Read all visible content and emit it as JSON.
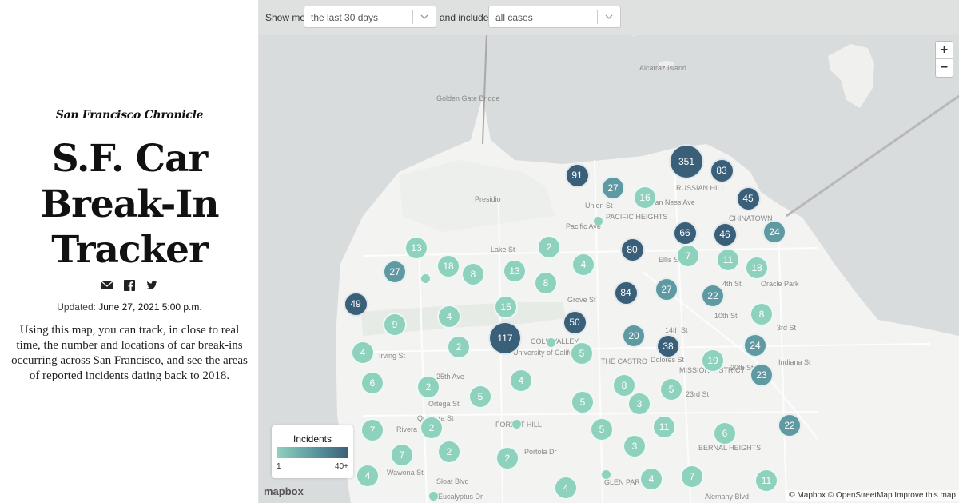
{
  "brand": "San Francisco Chronicle",
  "title_lines": [
    "S.F. Car",
    "Break-In",
    "Tracker"
  ],
  "share": {
    "email_icon": "email-icon",
    "facebook_icon": "facebook-icon",
    "twitter_icon": "twitter-icon"
  },
  "updated": {
    "label": "Updated:",
    "value": "June 27, 2021 5:00 p.m."
  },
  "intro": "Using this map, you can track, in close to real time, the number and locations of car break-ins occurring across San Francisco, and see the areas of reported incidents dating back to 2018.",
  "controls": {
    "show_me_label": "Show me",
    "period_value": "the last 30 days",
    "include_label": "and include",
    "cases_value": "all cases"
  },
  "zoom": {
    "in": "+",
    "out": "−"
  },
  "legend": {
    "title": "Incidents",
    "min": "1",
    "max": "40+"
  },
  "colors": {
    "low": "#8ed2bd",
    "mid": "#5f9aa3",
    "high": "#3a5f78",
    "water": "#d9dcdc",
    "land": "#f3f3f2"
  },
  "mapbox_logo": "mapbox",
  "attribution": "© Mapbox © OpenStreetMap Improve this map",
  "map_labels": [
    "Alcatraz Island",
    "Golden Gate Bridge",
    "Presidio",
    "RUSSIAN HILL",
    "Union St",
    "PACIFIC HEIGHTS",
    "CHINATOWN",
    "Pacific Ave",
    "Lake St",
    "Ellis St",
    "Oracle Park",
    "Grove St",
    "COLE VALLEY",
    "University of California",
    "Irving St",
    "14th St",
    "THE CASTRO",
    "MISSION DISTRICT",
    "20th St",
    "23rd St",
    "25th Ave",
    "Ortega St",
    "Quintara St",
    "Rivera St",
    "FOREST HILL",
    "Portola Dr",
    "Wawona St",
    "Sloat Blvd",
    "Eucalyptus Dr",
    "GLEN PARK",
    "BERNAL HEIGHTS",
    "Van Ness Ave",
    "10th St",
    "4th St",
    "3rd St",
    "Indiana St",
    "Dolores St",
    "Alemany Blvd"
  ],
  "clusters": [
    {
      "count": 351,
      "level": "high"
    },
    {
      "count": 83,
      "level": "high"
    },
    {
      "count": 91,
      "level": "high"
    },
    {
      "count": 27,
      "level": "mid"
    },
    {
      "count": 16,
      "level": "low"
    },
    {
      "count": 45,
      "level": "high"
    },
    {
      "count": 66,
      "level": "high"
    },
    {
      "count": 46,
      "level": "high"
    },
    {
      "count": 24,
      "level": "mid"
    },
    {
      "count": 13,
      "level": "low"
    },
    {
      "count": 2,
      "level": "low"
    },
    {
      "count": 80,
      "level": "high"
    },
    {
      "count": 7,
      "level": "low"
    },
    {
      "count": 11,
      "level": "low"
    },
    {
      "count": 18,
      "level": "low"
    },
    {
      "count": 27,
      "level": "mid"
    },
    {
      "count": 18,
      "level": "low"
    },
    {
      "count": 8,
      "level": "low"
    },
    {
      "count": 13,
      "level": "low"
    },
    {
      "count": 4,
      "level": "low"
    },
    {
      "count": 8,
      "level": "low"
    },
    {
      "count": 84,
      "level": "high"
    },
    {
      "count": 27,
      "level": "mid"
    },
    {
      "count": 22,
      "level": "mid"
    },
    {
      "count": 49,
      "level": "high"
    },
    {
      "count": 15,
      "level": "low"
    },
    {
      "count": 9,
      "level": "low"
    },
    {
      "count": 4,
      "level": "low"
    },
    {
      "count": 50,
      "level": "high"
    },
    {
      "count": 8,
      "level": "low"
    },
    {
      "count": 117,
      "level": "high"
    },
    {
      "count": 2,
      "level": "low"
    },
    {
      "count": 20,
      "level": "mid"
    },
    {
      "count": 38,
      "level": "high"
    },
    {
      "count": 24,
      "level": "mid"
    },
    {
      "count": 4,
      "level": "low"
    },
    {
      "count": 5,
      "level": "low"
    },
    {
      "count": 19,
      "level": "low"
    },
    {
      "count": 23,
      "level": "mid"
    },
    {
      "count": 6,
      "level": "low"
    },
    {
      "count": 2,
      "level": "low"
    },
    {
      "count": 4,
      "level": "low"
    },
    {
      "count": 5,
      "level": "low"
    },
    {
      "count": 8,
      "level": "low"
    },
    {
      "count": 5,
      "level": "low"
    },
    {
      "count": 3,
      "level": "low"
    },
    {
      "count": 5,
      "level": "low"
    },
    {
      "count": 22,
      "level": "mid"
    },
    {
      "count": 7,
      "level": "low"
    },
    {
      "count": 2,
      "level": "low"
    },
    {
      "count": 11,
      "level": "low"
    },
    {
      "count": 6,
      "level": "low"
    },
    {
      "count": 5,
      "level": "low"
    },
    {
      "count": 7,
      "level": "low"
    },
    {
      "count": 2,
      "level": "low"
    },
    {
      "count": 2,
      "level": "low"
    },
    {
      "count": 3,
      "level": "low"
    },
    {
      "count": 4,
      "level": "low"
    },
    {
      "count": 4,
      "level": "low"
    },
    {
      "count": 7,
      "level": "low"
    },
    {
      "count": 11,
      "level": "low"
    },
    {
      "count": 4,
      "level": "low"
    }
  ]
}
